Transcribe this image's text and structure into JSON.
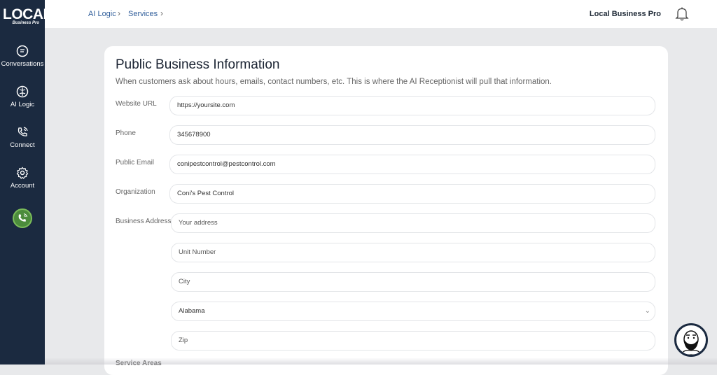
{
  "sidebar": {
    "logo_main": "LOCAL",
    "logo_sub": "Business Pro",
    "items": [
      {
        "label": "Conversations",
        "icon": "chat-icon"
      },
      {
        "label": "AI Logic",
        "icon": "brain-icon"
      },
      {
        "label": "Connect",
        "icon": "phone-call-icon"
      },
      {
        "label": "Account",
        "icon": "gear-icon"
      }
    ],
    "call_button_icon": "phone-ring-icon"
  },
  "header": {
    "breadcrumb": [
      "AI Logic",
      "Services"
    ],
    "company": "Local Business Pro",
    "bell_icon": "bell-icon"
  },
  "form": {
    "title": "Public Business Information",
    "subtitle": "When customers ask about hours, emails, contact numbers, etc. This is where the AI Receptionist will pull that information.",
    "website_label": "Website URL",
    "website_value": "https://yoursite.com",
    "phone_label": "Phone",
    "phone_value": "345678900",
    "email_label": "Public Email",
    "email_value": "conipestcontrol@pestcontrol.com",
    "org_label": "Organization",
    "org_value": "Coni's Pest Control",
    "address_label": "Business Address",
    "address_placeholder": "Your address",
    "unit_placeholder": "Unit Number",
    "city_placeholder": "City",
    "state_value": "Alabama",
    "zip_placeholder": "Zip",
    "next_section": "Service Areas"
  },
  "colors": {
    "sidebar": "#1b2a40",
    "call_button": "#4c8c3c",
    "breadcrumb": "#2f5d9a"
  }
}
